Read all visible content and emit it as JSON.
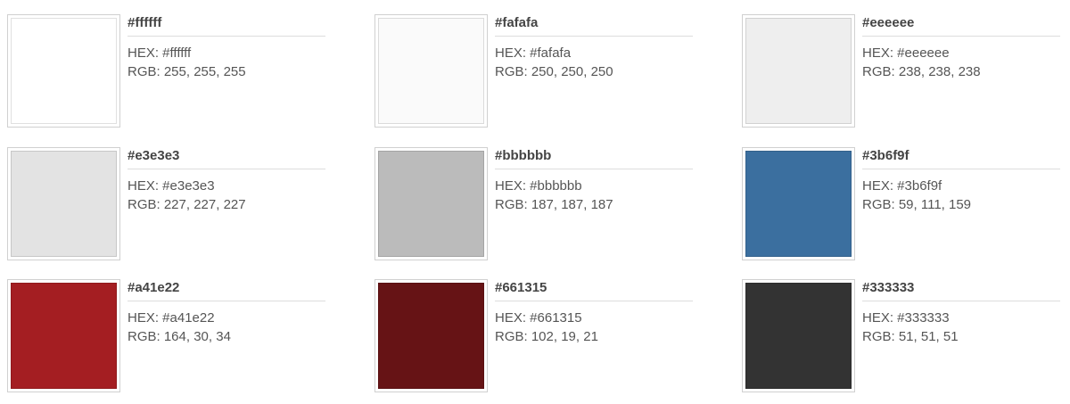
{
  "swatches": [
    {
      "title": "#ffffff",
      "hex": "HEX: #ffffff",
      "rgb": "RGB: 255, 255, 255",
      "color": "#ffffff"
    },
    {
      "title": "#fafafa",
      "hex": "HEX: #fafafa",
      "rgb": "RGB: 250, 250, 250",
      "color": "#fafafa"
    },
    {
      "title": "#eeeeee",
      "hex": "HEX: #eeeeee",
      "rgb": "RGB: 238, 238, 238",
      "color": "#eeeeee"
    },
    {
      "title": "#e3e3e3",
      "hex": "HEX: #e3e3e3",
      "rgb": "RGB: 227, 227, 227",
      "color": "#e3e3e3"
    },
    {
      "title": "#bbbbbb",
      "hex": "HEX: #bbbbbb",
      "rgb": "RGB: 187, 187, 187",
      "color": "#bbbbbb"
    },
    {
      "title": "#3b6f9f",
      "hex": "HEX: #3b6f9f",
      "rgb": "RGB: 59, 111, 159",
      "color": "#3b6f9f"
    },
    {
      "title": "#a41e22",
      "hex": "HEX: #a41e22",
      "rgb": "RGB: 164, 30, 34",
      "color": "#a41e22"
    },
    {
      "title": "#661315",
      "hex": "HEX: #661315",
      "rgb": "RGB: 102, 19, 21",
      "color": "#661315"
    },
    {
      "title": "#333333",
      "hex": "HEX: #333333",
      "rgb": "RGB: 51, 51, 51",
      "color": "#333333"
    }
  ]
}
